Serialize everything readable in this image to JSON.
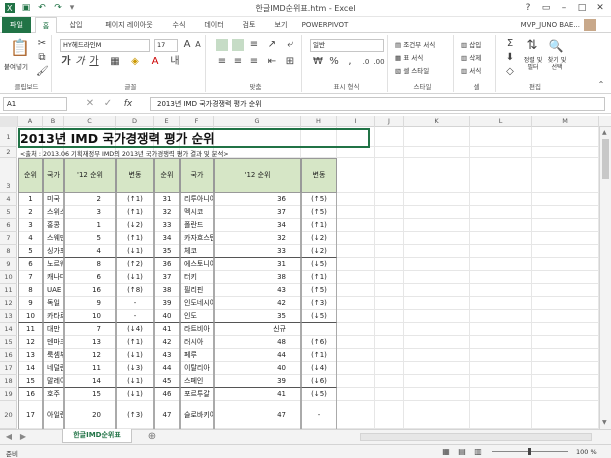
{
  "window": {
    "title": "한글IMD순위표.htm - Excel"
  },
  "tabs": [
    "파일",
    "홈",
    "삽입",
    "페이지 레이아웃",
    "수식",
    "데이터",
    "검토",
    "보기",
    "POWERPIVOT"
  ],
  "user": "MVP_JUNO BAE...",
  "ribbon": {
    "clipboard": {
      "label": "클립보드",
      "paste": "붙여넣기"
    },
    "font": {
      "label": "글꼴",
      "name": "HY헤드라인M",
      "size": "17"
    },
    "align": {
      "label": "맞춤"
    },
    "number": {
      "label": "표시 형식",
      "format": "일반",
      "percent": "%",
      "comma": ","
    },
    "styles": {
      "label": "스타일",
      "conditional": "조건부 서식",
      "table": "표 서식",
      "cell": "셀 스타일"
    },
    "cells": {
      "label": "셀",
      "insert": "삽입",
      "delete": "삭제",
      "format": "서식"
    },
    "editing": {
      "label": "편집",
      "sort": "정렬 및 필터",
      "find": "찾기 및 선택"
    }
  },
  "formula_bar": {
    "name_box": "A1",
    "fx": "fx",
    "formula": "2013년 IMD 국가경쟁력 평가 순위"
  },
  "columns": [
    "A",
    "B",
    "C",
    "D",
    "E",
    "F",
    "G",
    "H",
    "I",
    "J",
    "K",
    "L",
    "M"
  ],
  "rows": [
    "1",
    "2",
    "3",
    "4",
    "5",
    "6",
    "7",
    "8",
    "9",
    "10",
    "11",
    "12",
    "13",
    "14",
    "15",
    "16",
    "17",
    "18",
    "19",
    "20"
  ],
  "sheet": {
    "title": "2013년 IMD 국가경쟁력 평가 순위",
    "subtitle": "<출처 : 2013.06 기획재정부 IMD의 2013년 국가경쟁력 평가 결과 및 분석>",
    "headers": {
      "rank": "순위",
      "country": "국가",
      "prev": "'12 순위",
      "change": "변동"
    },
    "left": [
      [
        "1",
        "미국",
        "2",
        "(↑1)"
      ],
      [
        "2",
        "스위스",
        "3",
        "(↑1)"
      ],
      [
        "3",
        "홍콩",
        "1",
        "(↓2)"
      ],
      [
        "4",
        "스웨덴",
        "5",
        "(↑1)"
      ],
      [
        "5",
        "싱가포르",
        "4",
        "(↓1)"
      ],
      [
        "6",
        "노르웨이",
        "8",
        "(↑2)"
      ],
      [
        "7",
        "캐나다",
        "6",
        "(↓1)"
      ],
      [
        "8",
        "UAE",
        "16",
        "(↑8)"
      ],
      [
        "9",
        "독일",
        "9",
        "-"
      ],
      [
        "10",
        "카타르",
        "10",
        "-"
      ],
      [
        "11",
        "대만",
        "7",
        "(↓4)"
      ],
      [
        "12",
        "덴마크",
        "13",
        "(↑1)"
      ],
      [
        "13",
        "룩셈부르크",
        "12",
        "(↓1)"
      ],
      [
        "14",
        "네덜란드",
        "11",
        "(↓3)"
      ],
      [
        "15",
        "말레이시아",
        "14",
        "(↓1)"
      ],
      [
        "16",
        "호주",
        "15",
        "(↓1)"
      ],
      [
        "17",
        "아일랜드",
        "20",
        "(↑3)"
      ]
    ],
    "right": [
      [
        "31",
        "리투아니아",
        "36",
        "(↑5)"
      ],
      [
        "32",
        "멕시코",
        "37",
        "(↑5)"
      ],
      [
        "33",
        "폴란드",
        "34",
        "(↑1)"
      ],
      [
        "34",
        "카자흐스탄",
        "32",
        "(↓2)"
      ],
      [
        "35",
        "체코",
        "33",
        "(↓2)"
      ],
      [
        "36",
        "에스토니아",
        "31",
        "(↓5)"
      ],
      [
        "37",
        "터키",
        "38",
        "(↑1)"
      ],
      [
        "38",
        "필리핀",
        "43",
        "(↑5)"
      ],
      [
        "39",
        "인도네시아",
        "42",
        "(↑3)"
      ],
      [
        "40",
        "인도",
        "35",
        "(↓5)"
      ],
      [
        "41",
        "라트비아",
        "신규",
        ""
      ],
      [
        "42",
        "러시아",
        "48",
        "(↑6)"
      ],
      [
        "43",
        "페루",
        "44",
        "(↑1)"
      ],
      [
        "44",
        "이탈리아",
        "40",
        "(↓4)"
      ],
      [
        "45",
        "스페인",
        "39",
        "(↓6)"
      ],
      [
        "46",
        "포르투갈",
        "41",
        "(↓5)"
      ],
      [
        "47",
        "슬로바키아",
        "47",
        "-"
      ]
    ]
  },
  "sheet_tab": "한글IMD순위표",
  "status": {
    "left": "준비",
    "zoom": "100 %"
  }
}
